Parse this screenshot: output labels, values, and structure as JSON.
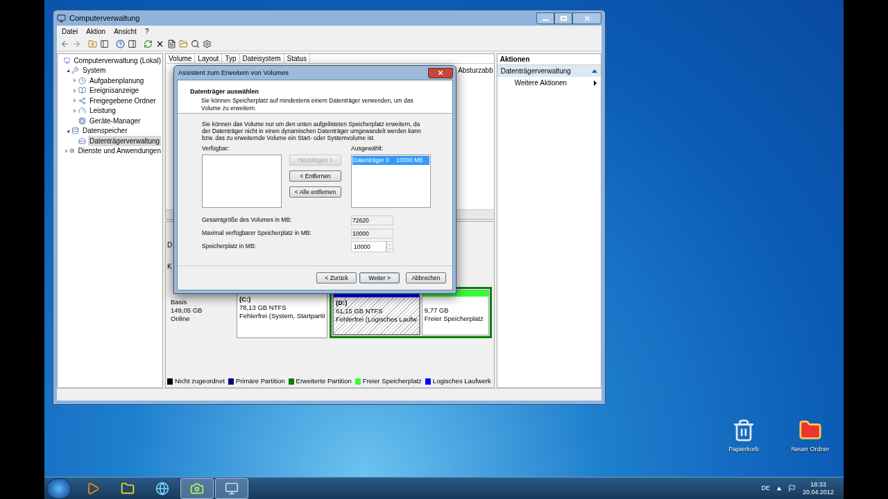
{
  "window": {
    "title": "Computerverwaltung"
  },
  "menu": [
    "Datei",
    "Aktion",
    "Ansicht",
    "?"
  ],
  "tree": [
    {
      "label": "Computerverwaltung (Lokal)",
      "selected": false,
      "children": [
        {
          "label": "System",
          "expanded": true,
          "selected": false,
          "children": [
            {
              "label": "Aufgabenplanung",
              "expanded": false,
              "selected": false
            },
            {
              "label": "Ereignisanzeige",
              "expanded": false,
              "selected": false
            },
            {
              "label": "Freigegebene Ordner",
              "expanded": false,
              "selected": false
            },
            {
              "label": "Leistung",
              "expanded": false,
              "selected": false
            },
            {
              "label": "Geräte-Manager",
              "selected": false
            }
          ]
        },
        {
          "label": "Datenspeicher",
          "expanded": true,
          "selected": false,
          "children": [
            {
              "label": "Datenträgerverwaltung",
              "selected": true
            }
          ]
        },
        {
          "label": "Dienste und Anwendungen",
          "expanded": false,
          "selected": false
        }
      ]
    }
  ],
  "table": {
    "columns": [
      "Volume",
      "Layout",
      "Typ",
      "Dateisystem",
      "Status"
    ],
    "visible_cell": "Absturzabb",
    "left_letters": [
      "D",
      "K"
    ]
  },
  "disk": {
    "info": [
      "Basis",
      "149,05 GB",
      "Online"
    ],
    "partitions": [
      {
        "kind": "primary",
        "name": "(C:)",
        "size": "78,13 GB NTFS",
        "status": "Fehlerfrei (System, Startpartit",
        "selected": false
      },
      {
        "kind": "extended",
        "children": [
          {
            "kind": "logical",
            "name": "(D:)",
            "size": "61,15 GB NTFS",
            "status": "Fehlerfrei (Logisches Laufw",
            "selected": true
          },
          {
            "kind": "free",
            "size": "9,77 GB",
            "status": "Freier Speicherplatz",
            "selected": false
          }
        ]
      }
    ]
  },
  "legend": [
    {
      "label": "Nicht zugeordnet",
      "color": "#000000"
    },
    {
      "label": "Primäre Partition",
      "color": "#000080"
    },
    {
      "label": "Erweiterte Partition",
      "color": "#008000"
    },
    {
      "label": "Freier Speicherplatz",
      "color": "#33ff33"
    },
    {
      "label": "Logisches Laufwerk",
      "color": "#0000ff"
    }
  ],
  "actions": {
    "title": "Aktionen",
    "section": {
      "label": "Datenträgerverwaltung",
      "expanded": true
    },
    "items": [
      "Weitere Aktionen"
    ]
  },
  "dialog": {
    "title": "Assistent zum Erweitern von Volumes",
    "heading": "Datenträger auswählen",
    "subheading": "Sie können Speicherplatz auf mindestens einem Datenträger verwenden, um das Volume zu erweitern.",
    "info": "Sie können das Volume nur um den unten aufgelisteten Speicherplatz erweitern, da der Datenträger nicht in einen dynamischen Datenträger umgewandelt werden kann bzw. das zu erweiternde Volume ein Start- oder Systemvolume ist.",
    "available_label": "Verfügbar:",
    "selected_label": "Ausgewählt:",
    "selected_items": [
      {
        "disk": "Datenträger 0",
        "size": "10000 MB",
        "selected": true
      }
    ],
    "move_buttons": [
      {
        "label": "Hinzufügen >",
        "disabled": true
      },
      {
        "label": "< Entfernen",
        "disabled": false
      },
      {
        "label": "< Alle entfernen",
        "disabled": false
      }
    ],
    "fields": [
      {
        "label": "Gesamtgröße des Volumes in MB:",
        "value": "72620",
        "kind": "readonly"
      },
      {
        "label": "Maximal verfügbarer Speicherplatz in MB:",
        "value": "10000",
        "kind": "readonly"
      },
      {
        "label": "Speicherplatz in MB:",
        "value": "10000",
        "kind": "spinner"
      }
    ],
    "buttons": [
      {
        "label": "< Zurück",
        "default": false
      },
      {
        "label": "Weiter >",
        "default": true
      },
      {
        "label": "Abbrechen",
        "default": false
      }
    ]
  },
  "desktop_icons": [
    {
      "label": "Papierkorb",
      "kind": "bin"
    },
    {
      "label": "Neuer Ordner",
      "kind": "folder"
    }
  ],
  "taskbar": {
    "apps": [
      {
        "kind": "media",
        "running": false
      },
      {
        "kind": "explorer",
        "running": false
      },
      {
        "kind": "browser",
        "running": false
      },
      {
        "kind": "camera",
        "running": true
      },
      {
        "kind": "management",
        "running": true
      }
    ],
    "language": "DE",
    "time": "18:33",
    "date": "20.04.2012"
  }
}
